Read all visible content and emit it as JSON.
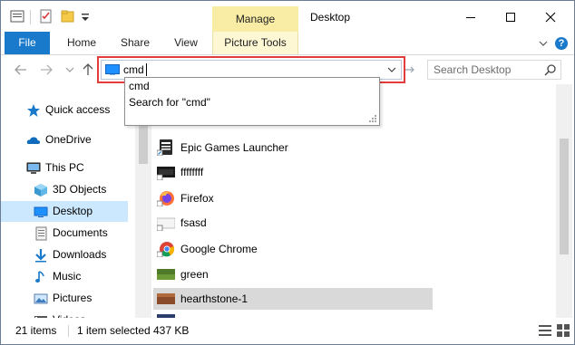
{
  "window": {
    "title": "Desktop",
    "context_tab": "Manage",
    "controls": {
      "minimize": "—",
      "maximize": "☐",
      "close": "✕"
    }
  },
  "ribbon": {
    "file": "File",
    "tabs": [
      "Home",
      "Share",
      "View",
      "Picture Tools"
    ],
    "help_glyph": "?"
  },
  "address": {
    "value": "cmd",
    "search_placeholder": "Search Desktop",
    "suggestions": [
      "cmd",
      "Search for \"cmd\""
    ]
  },
  "sidebar": {
    "items": [
      {
        "label": "Quick access",
        "icon": "star-icon",
        "selected": false
      },
      {
        "label": "OneDrive",
        "icon": "cloud-icon",
        "selected": false
      },
      {
        "label": "This PC",
        "icon": "computer-icon",
        "selected": false
      },
      {
        "label": "3D Objects",
        "icon": "cube-icon",
        "selected": false
      },
      {
        "label": "Desktop",
        "icon": "desktop-icon",
        "selected": true
      },
      {
        "label": "Documents",
        "icon": "documents-icon",
        "selected": false
      },
      {
        "label": "Downloads",
        "icon": "download-arrow-icon",
        "selected": false
      },
      {
        "label": "Music",
        "icon": "music-note-icon",
        "selected": false
      },
      {
        "label": "Pictures",
        "icon": "pictures-icon",
        "selected": false
      },
      {
        "label": "Videos",
        "icon": "videos-icon",
        "selected": false
      }
    ]
  },
  "files": [
    {
      "name": "Epic Games Launcher",
      "icon": "epic-games-icon",
      "selected": false
    },
    {
      "name": "ffffffff",
      "icon": "image-thumbnail-icon",
      "selected": false
    },
    {
      "name": "Firefox",
      "icon": "firefox-icon",
      "selected": false
    },
    {
      "name": "fsasd",
      "icon": "image-thumbnail-icon",
      "selected": false
    },
    {
      "name": "Google Chrome",
      "icon": "chrome-icon",
      "selected": false
    },
    {
      "name": "green",
      "icon": "image-thumbnail-icon",
      "selected": false
    },
    {
      "name": "hearthstone-1",
      "icon": "image-thumbnail-icon",
      "selected": true
    }
  ],
  "status": {
    "count": "21 items",
    "selection": "1 item selected",
    "size": "437 KB"
  },
  "colors": {
    "accent": "#1979ca",
    "manage_tab": "#f9eda5",
    "highlight_border": "#e23c3c",
    "sidebar_selected": "#cce8ff",
    "row_selected": "#d9d9d9"
  }
}
